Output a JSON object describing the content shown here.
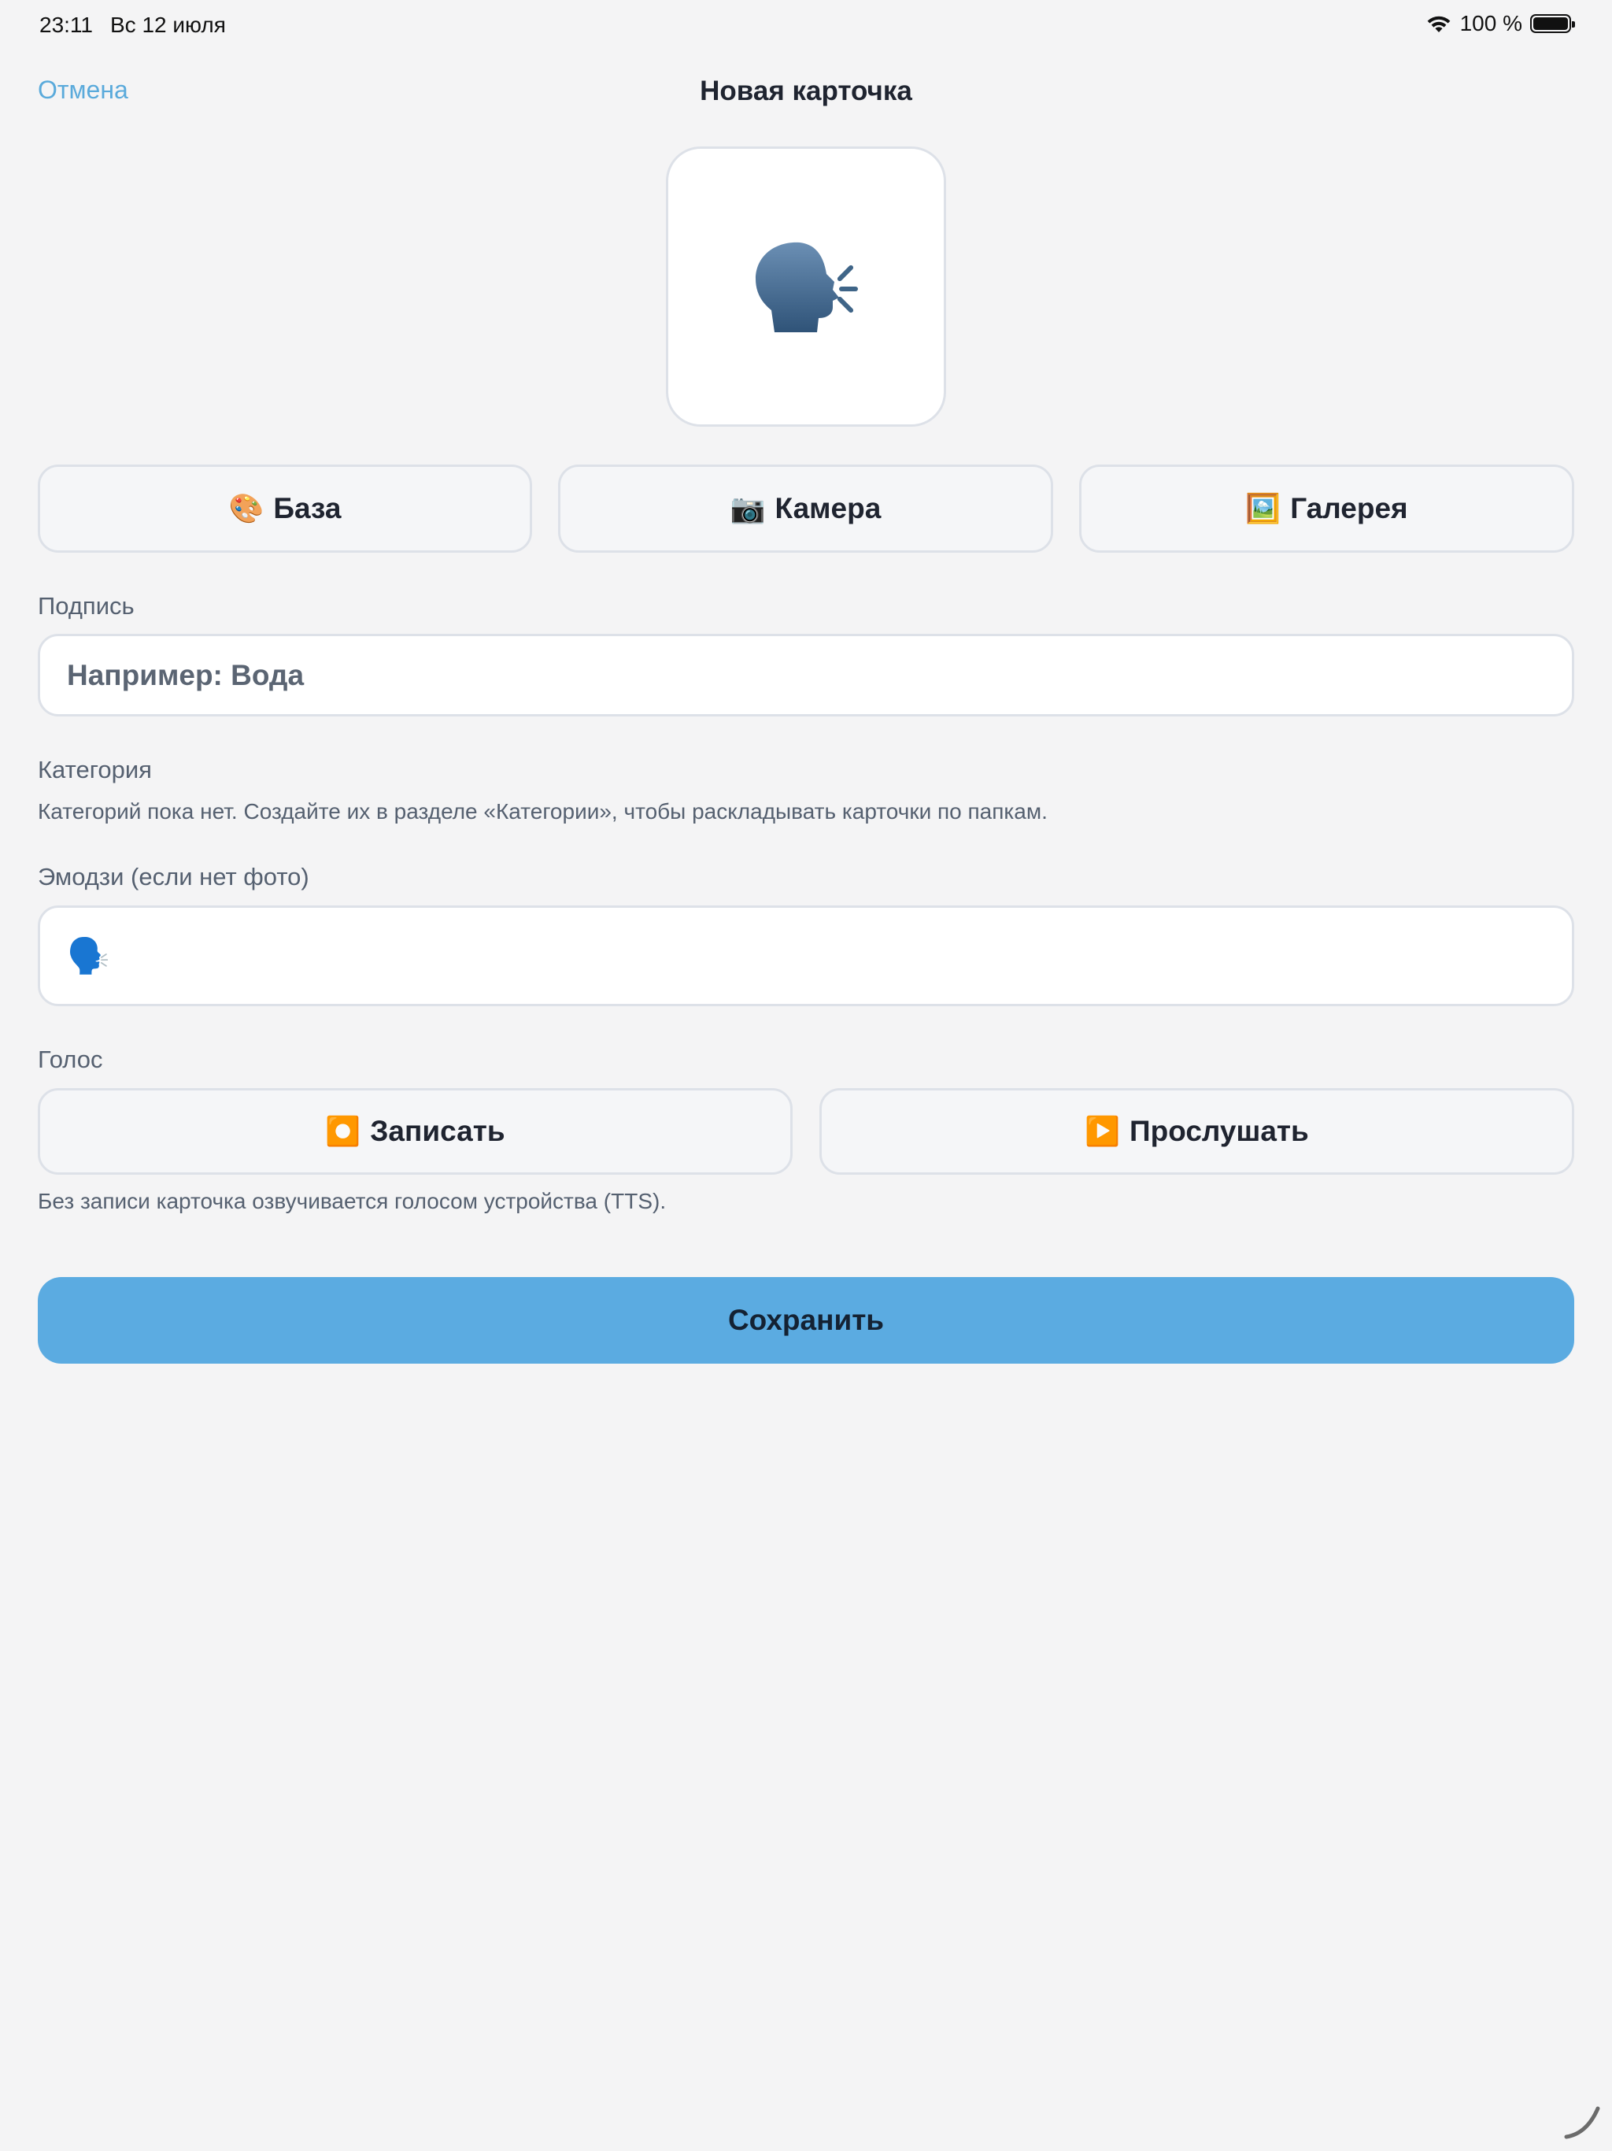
{
  "status_bar": {
    "time": "23:11",
    "date": "Вс 12 июля",
    "battery": "100 %",
    "battery_level": 1.0,
    "icons": [
      "wifi-icon",
      "battery-icon"
    ]
  },
  "nav": {
    "cancel_label": "Отмена",
    "title": "Новая карточка"
  },
  "preview": {
    "icon": "speaking-head-icon"
  },
  "source_buttons": [
    {
      "icon": "palette-icon",
      "glyph": "🎨",
      "label": "База"
    },
    {
      "icon": "camera-icon",
      "glyph": "📷",
      "label": "Камера"
    },
    {
      "icon": "picture-icon",
      "glyph": "🖼️",
      "label": "Галерея"
    }
  ],
  "caption": {
    "label": "Подпись",
    "value": "",
    "placeholder": "Например: Вода"
  },
  "category": {
    "label": "Категория",
    "hint": "Категорий пока нет. Создайте их в разделе «Категории», чтобы раскладывать карточки по папкам."
  },
  "emoji": {
    "label": "Эмодзи (если нет фото)",
    "value": "🗣️"
  },
  "voice": {
    "label": "Голос",
    "record": {
      "icon": "record-icon",
      "glyph": "⏺️",
      "label": "Записать"
    },
    "play": {
      "icon": "play-icon",
      "glyph": "▶️",
      "label": "Прослушать"
    },
    "hint": "Без записи карточка озвучивается голосом устройства (TTS)."
  },
  "save_label": "Сохранить",
  "colors": {
    "accent": "#5babe1",
    "link": "#5aaadb",
    "background": "#f4f4f5",
    "border": "#dde1e8"
  }
}
